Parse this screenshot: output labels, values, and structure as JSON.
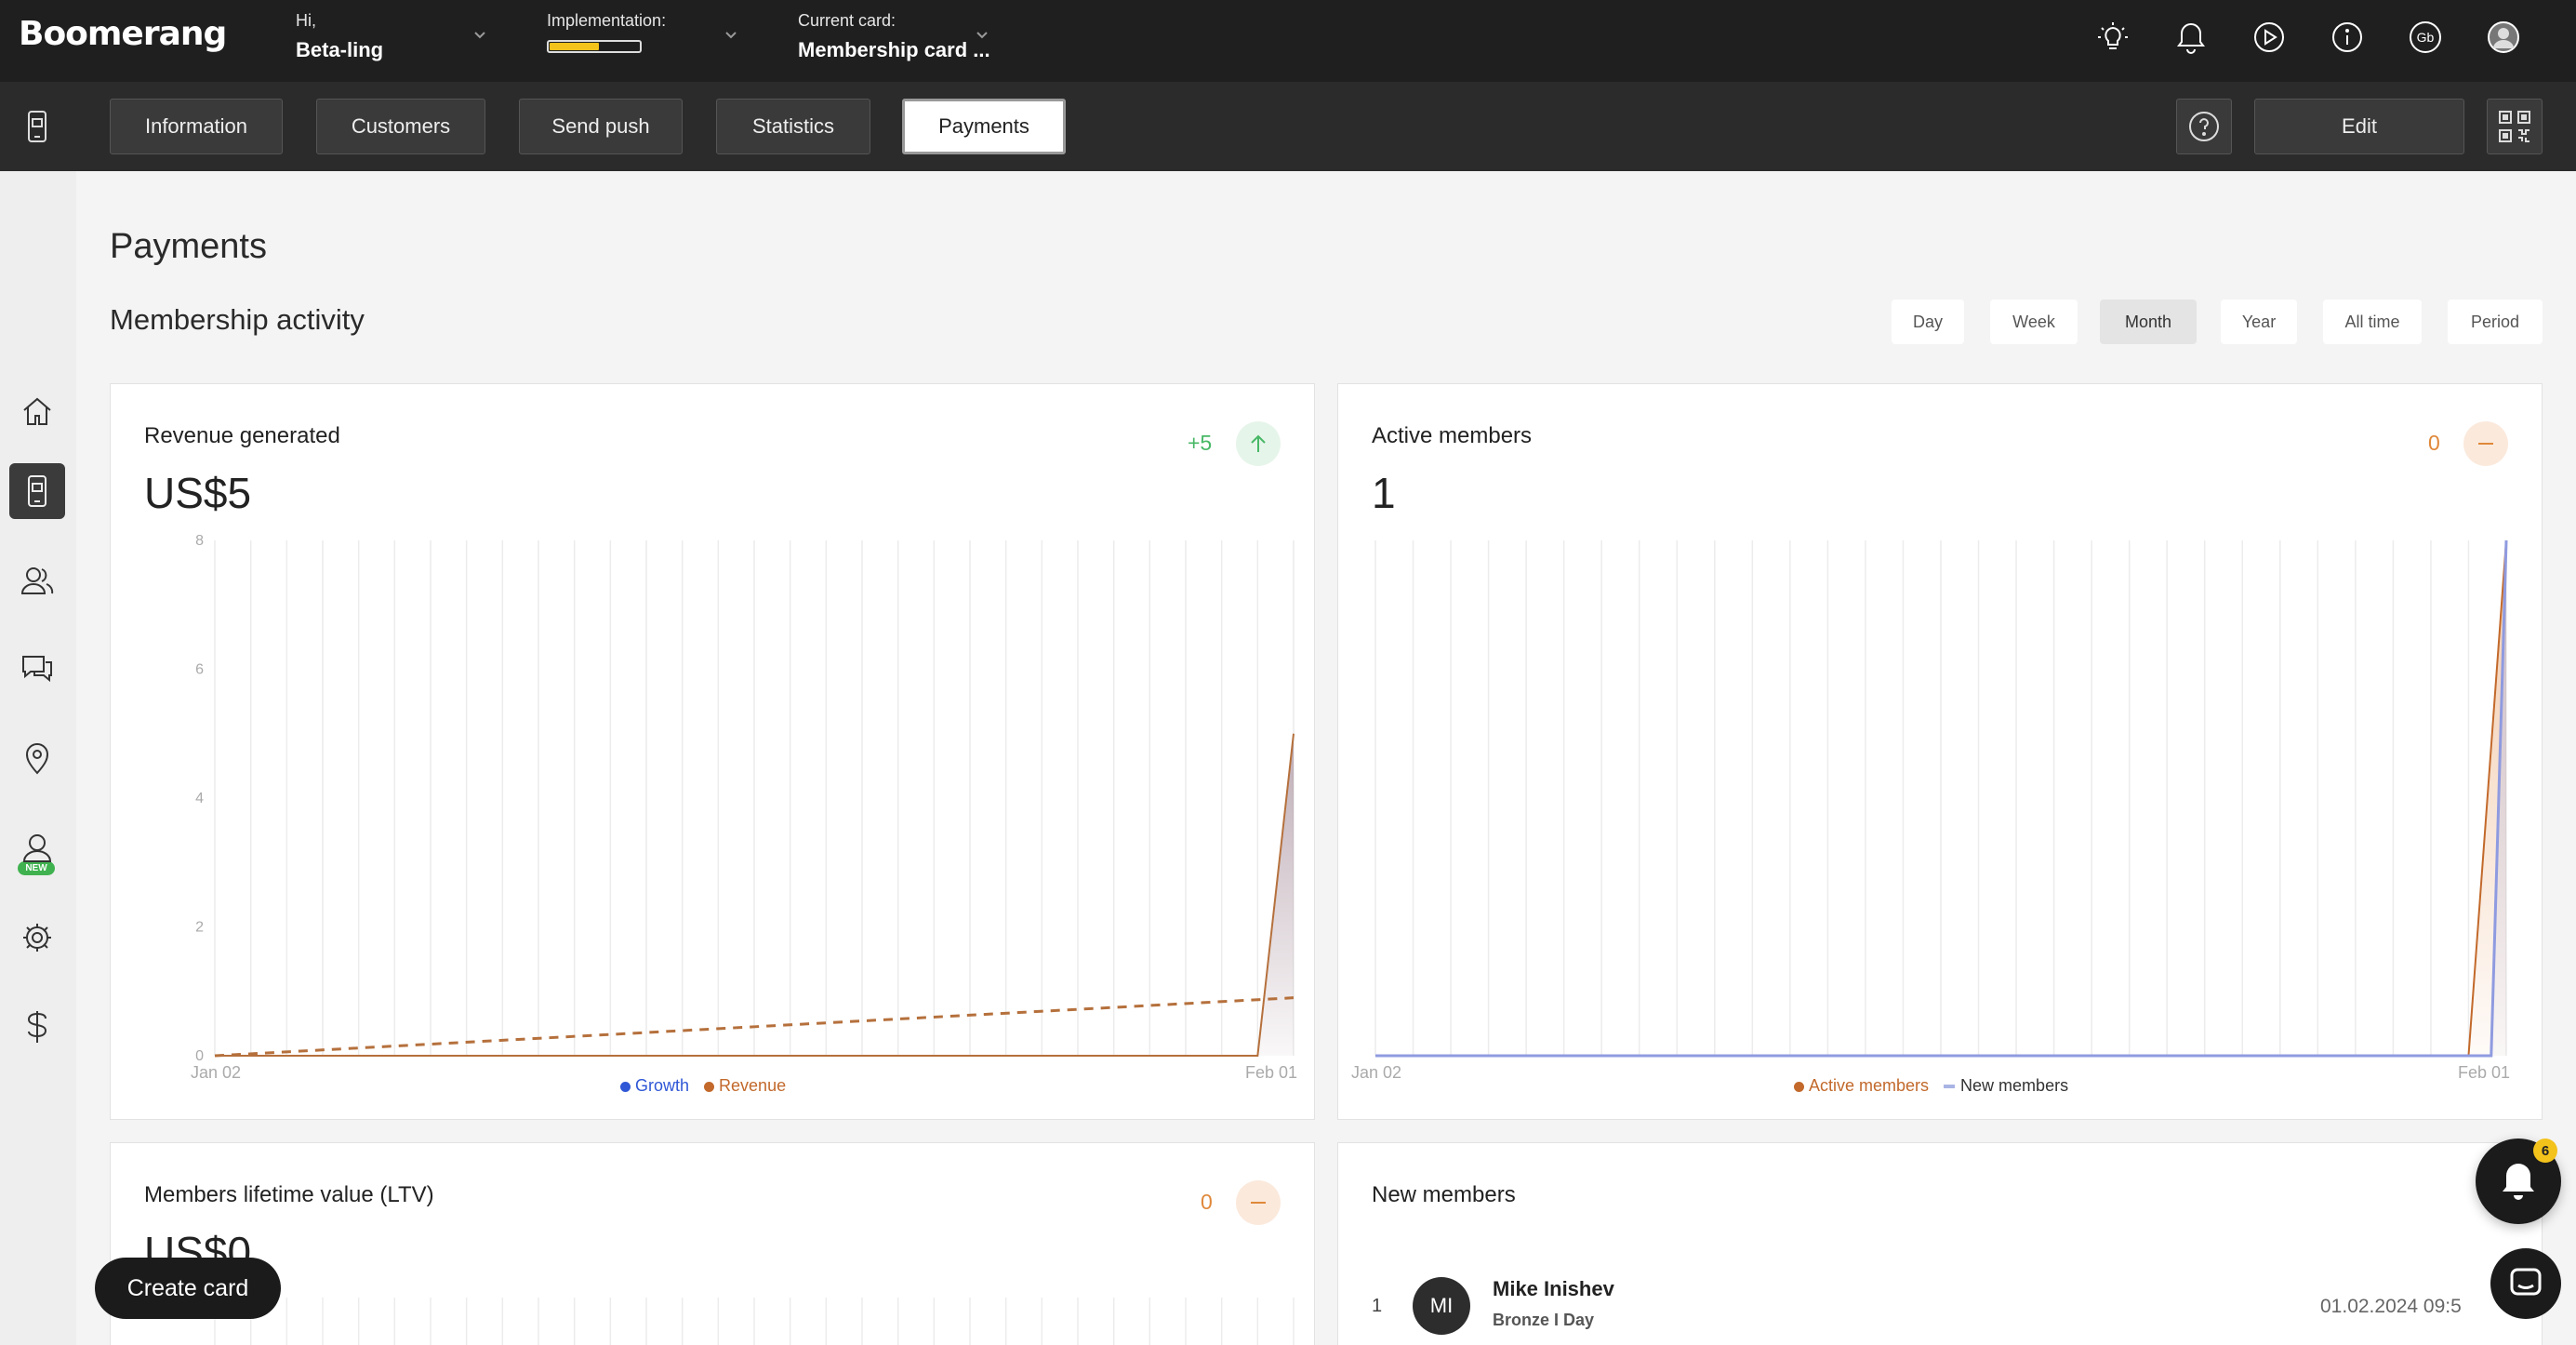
{
  "app": {
    "logo": "Boomerang"
  },
  "topbar": {
    "greeting": "Hi,",
    "user": "Beta-ling",
    "implementation_label": "Implementation:",
    "implementation_progress": 0.55,
    "current_card_label": "Current card:",
    "current_card": "Membership card ...",
    "icons": [
      "lightbulb-icon",
      "bell-icon",
      "play-icon",
      "info-icon",
      "gb-avatar-icon",
      "user-avatar-icon"
    ],
    "gb_text": "Gb"
  },
  "tabs": [
    {
      "label": "Information",
      "active": false
    },
    {
      "label": "Customers",
      "active": false
    },
    {
      "label": "Send push",
      "active": false
    },
    {
      "label": "Statistics",
      "active": false
    },
    {
      "label": "Payments",
      "active": true
    }
  ],
  "subbar": {
    "help_icon": "question-icon",
    "edit_label": "Edit",
    "qr_icon": "qr-code-icon"
  },
  "sidebar": {
    "items": [
      "home-icon",
      "phone-card-icon",
      "customers-icon",
      "chat-icon",
      "location-icon",
      "user-icon",
      "settings-icon",
      "dollar-icon"
    ],
    "new_badge": "NEW"
  },
  "page": {
    "title": "Payments",
    "section": "Membership activity",
    "periods": [
      "Day",
      "Week",
      "Month",
      "Year",
      "All time",
      "Period"
    ],
    "active_period": "Month"
  },
  "cards": {
    "revenue": {
      "title": "Revenue generated",
      "value": "US$5",
      "delta": "+5",
      "legend": [
        "Growth",
        "Revenue"
      ],
      "x_start": "Jan 02",
      "x_end": "Feb 01",
      "y_ticks": [
        "8",
        "6",
        "4",
        "2",
        "0"
      ]
    },
    "active": {
      "title": "Active members",
      "value": "1",
      "delta": "0",
      "legend": [
        "Active members",
        "New members"
      ],
      "x_start": "Jan 02",
      "x_end": "Feb 01"
    },
    "ltv": {
      "title": "Members lifetime value (LTV)",
      "value": "US$0",
      "delta": "0"
    },
    "new_members": {
      "title": "New members",
      "rows": [
        {
          "index": "1",
          "initials": "MI",
          "name": "Mike Inishev",
          "tier": "Bronze I Day",
          "date": "01.02.2024 09:5"
        }
      ]
    }
  },
  "floating": {
    "create_card": "Create card",
    "notification_count": "6"
  },
  "colors": {
    "revenue": "#c2692b",
    "growth": "#2f57d6",
    "new_members": "#a9b4e4",
    "positive": "#48b866",
    "neutral": "#e0883a"
  },
  "chart_data": [
    {
      "type": "area",
      "title": "Revenue generated",
      "x_labels": [
        "Jan 02",
        "Feb 01"
      ],
      "ylim": [
        0,
        8
      ],
      "series": [
        {
          "name": "Revenue",
          "points": [
            [
              0,
              0
            ],
            [
              29,
              0
            ],
            [
              30,
              5
            ]
          ]
        },
        {
          "name": "Growth",
          "points": [
            [
              0,
              0
            ],
            [
              30,
              0.9
            ]
          ]
        }
      ]
    },
    {
      "type": "area",
      "title": "Active members",
      "x_labels": [
        "Jan 02",
        "Feb 01"
      ],
      "ylim": [
        0,
        1
      ],
      "series": [
        {
          "name": "Active members",
          "points": [
            [
              0,
              0
            ],
            [
              29,
              0
            ],
            [
              30,
              1
            ]
          ]
        },
        {
          "name": "New members",
          "points": [
            [
              0,
              0
            ],
            [
              29.6,
              0
            ],
            [
              30,
              1
            ]
          ]
        }
      ]
    }
  ]
}
